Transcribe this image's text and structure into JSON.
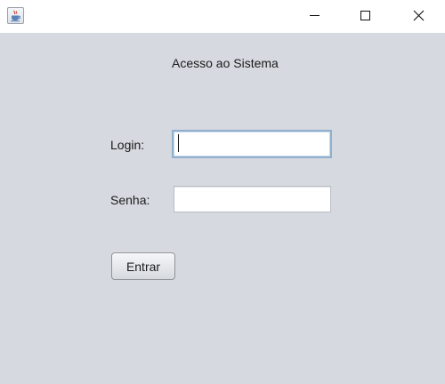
{
  "window": {
    "icon": "java-coffee-cup-icon",
    "controls": {
      "minimize_icon": "minimize-icon",
      "maximize_icon": "maximize-icon",
      "close_icon": "close-icon"
    }
  },
  "form": {
    "title": "Acesso ao Sistema",
    "login_label": "Login:",
    "login_value": "",
    "password_label": "Senha:",
    "password_value": "",
    "submit_label": "Entrar"
  },
  "colors": {
    "window_background": "#d6d9e0",
    "titlebar_background": "#ffffff",
    "focused_field_border": "#8fb0cf"
  }
}
